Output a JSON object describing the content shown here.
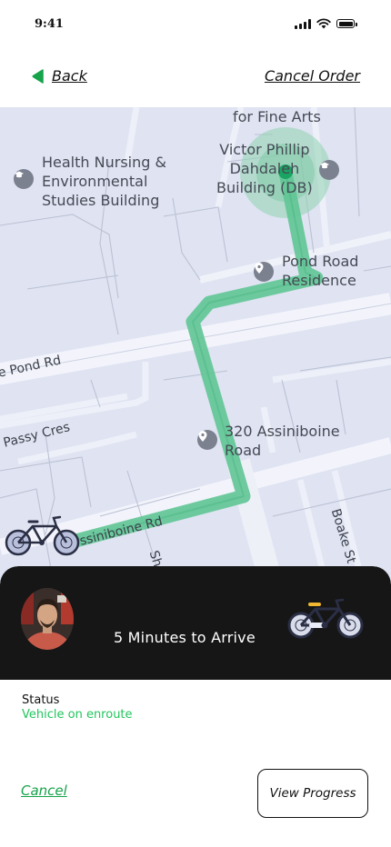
{
  "status_bar": {
    "time": "9:41"
  },
  "nav": {
    "back_label": "Back",
    "cancel_order_label": "Cancel Order"
  },
  "map": {
    "labels": {
      "fine_arts": "for Fine Arts",
      "health_nursing_1": "Health Nursing &",
      "health_nursing_2": "Environmental",
      "health_nursing_3": "Studies Building",
      "victor_1": "Victor Phillip",
      "victor_2": "Dahdaleh",
      "victor_3": "Building (DB)",
      "pond_res_1": "Pond Road",
      "pond_res_2": "Residence",
      "assiniboine_320_1": "320 Assiniboine",
      "assiniboine_320_2": "Road"
    },
    "streets": {
      "pond_rd": "e Pond Rd",
      "passy": "Passy Cres",
      "assiniboine_rd": "ssiniboine Rd",
      "boake": "Boake St",
      "sh": "Sh"
    },
    "colors": {
      "route": "#5fc593",
      "destination": "#1aa463",
      "background": "#dfe3f2"
    }
  },
  "trip": {
    "eta_text": "5 Minutes to Arrive",
    "status_label": "Status",
    "status_value": "Vehicle on enroute",
    "cancel_label": "Cancel",
    "view_progress_label": "View Progress"
  }
}
